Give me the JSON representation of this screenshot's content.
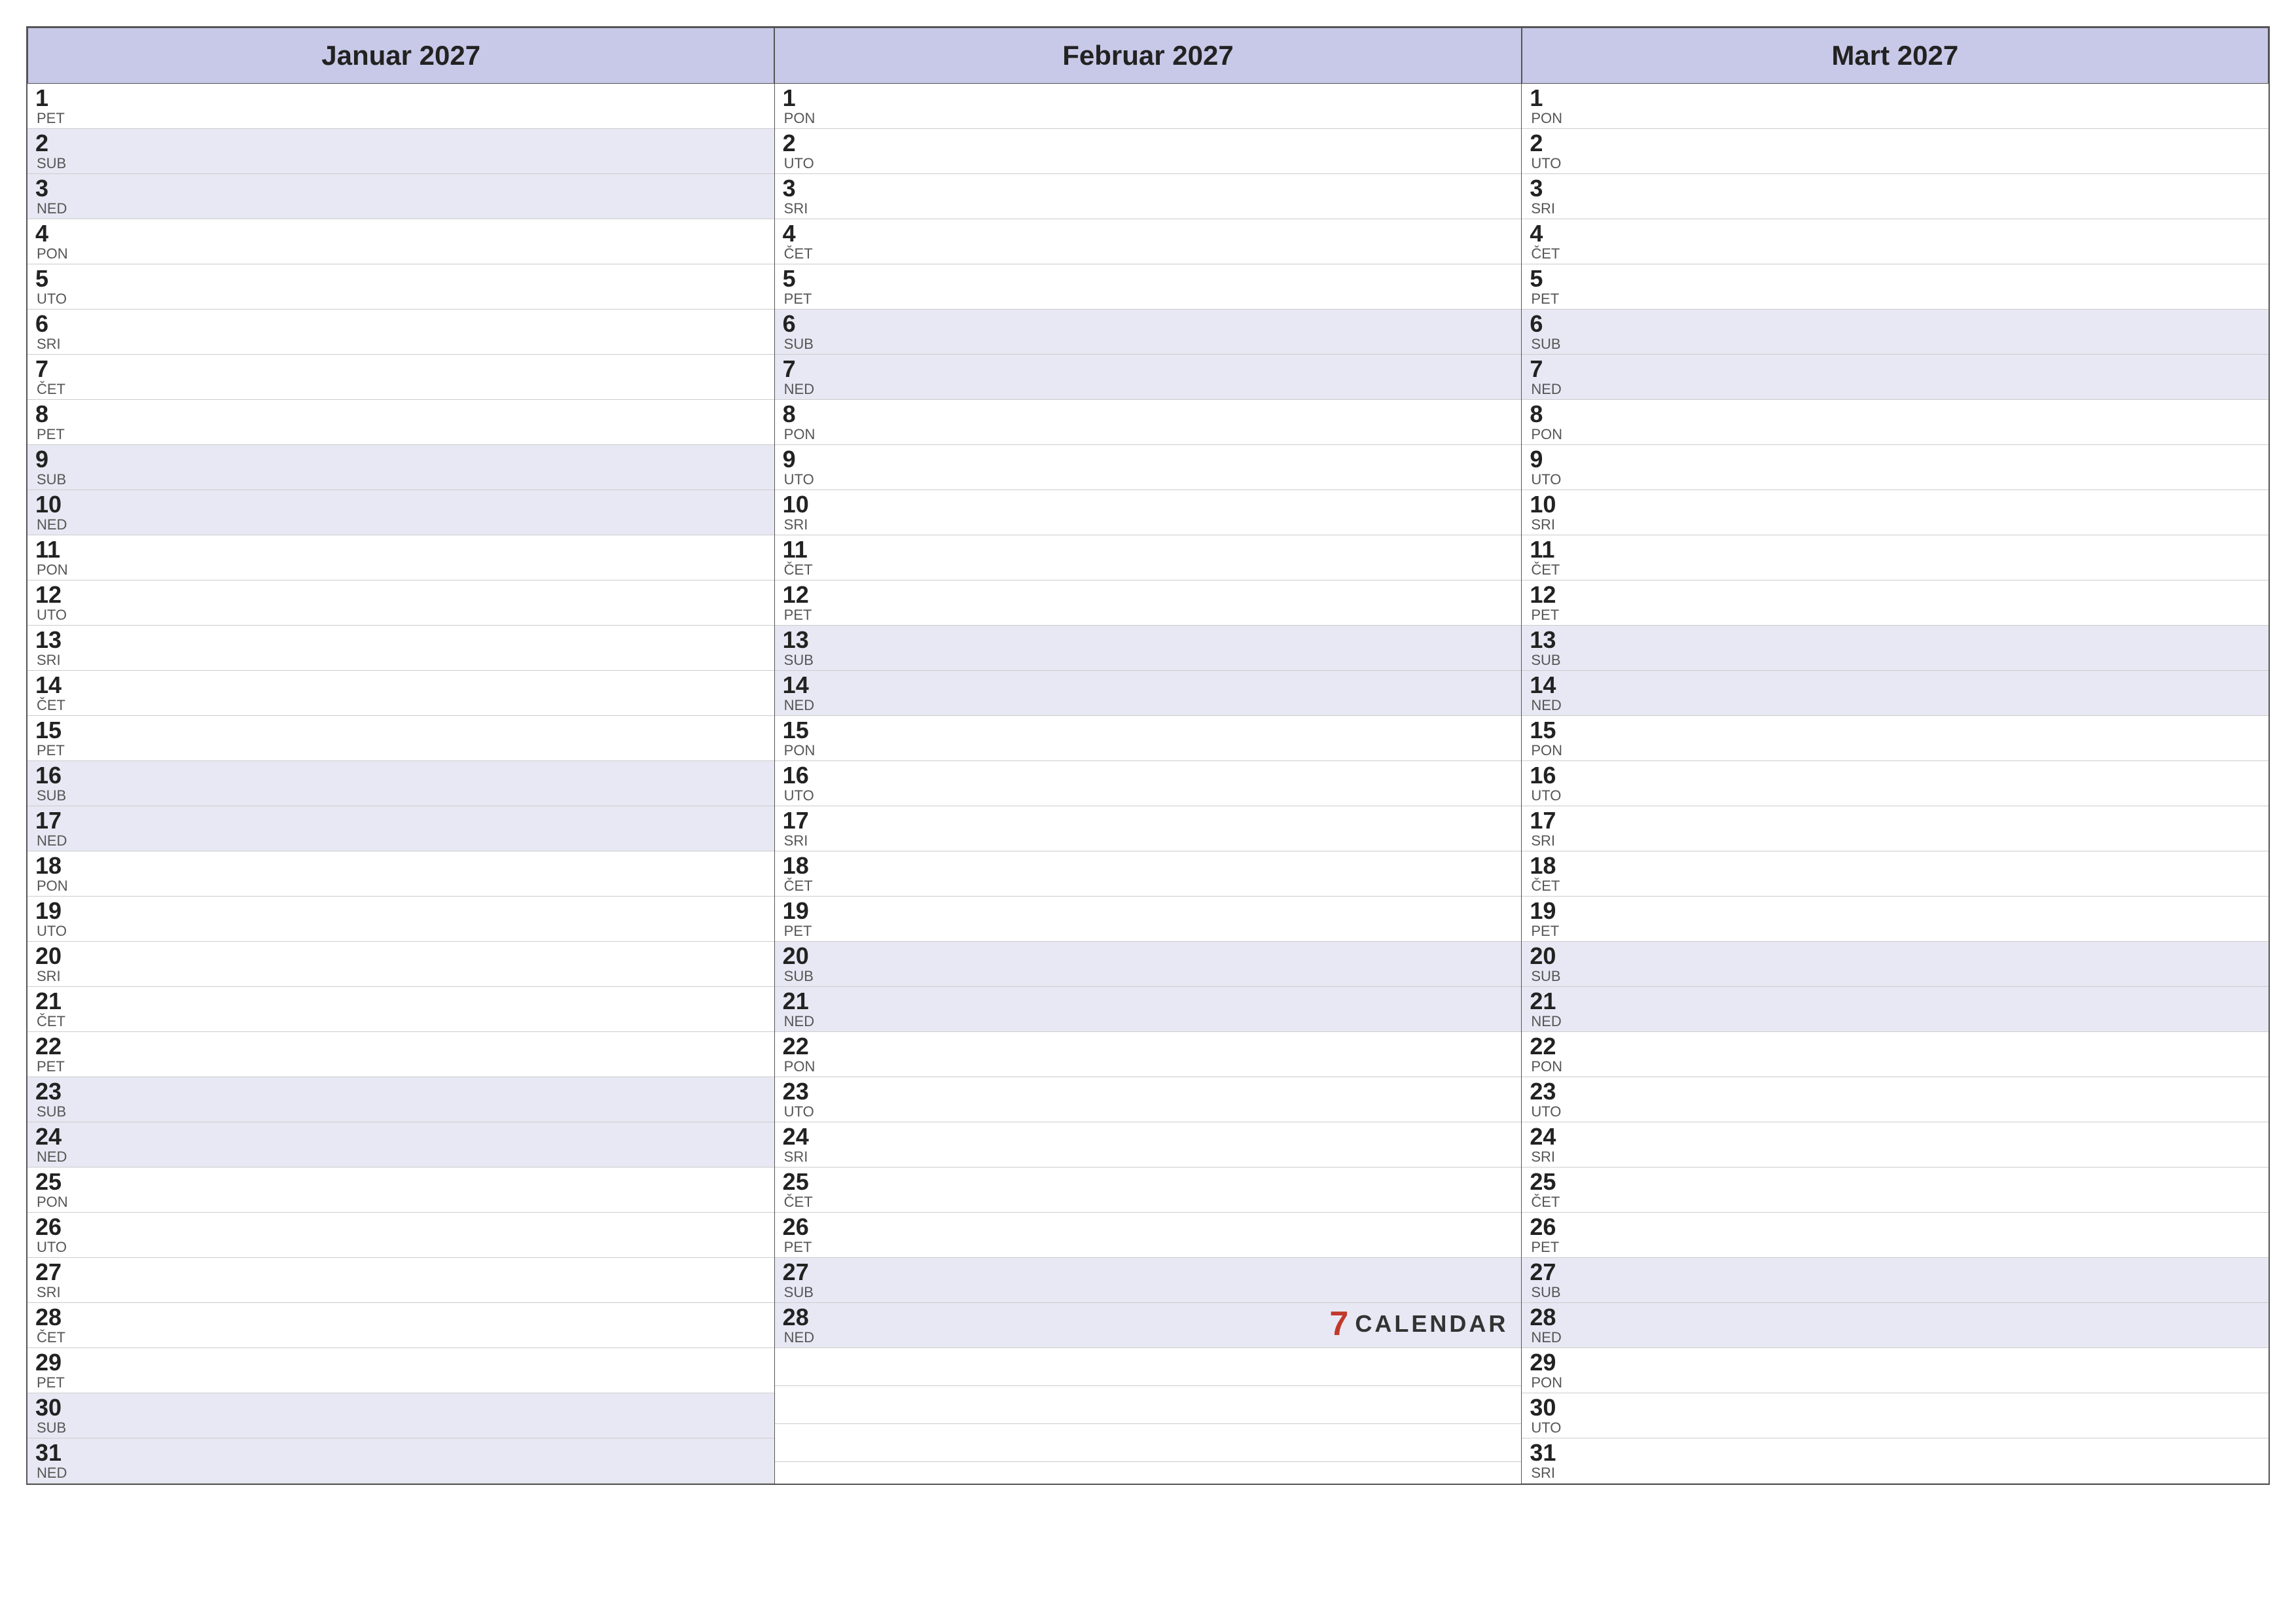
{
  "calendar": {
    "months": [
      {
        "id": "jan-2027",
        "title": "Januar 2027",
        "days": [
          {
            "num": "1",
            "name": "PET",
            "weekend": false
          },
          {
            "num": "2",
            "name": "SUB",
            "weekend": true
          },
          {
            "num": "3",
            "name": "NED",
            "weekend": true
          },
          {
            "num": "4",
            "name": "PON",
            "weekend": false
          },
          {
            "num": "5",
            "name": "UTO",
            "weekend": false
          },
          {
            "num": "6",
            "name": "SRI",
            "weekend": false
          },
          {
            "num": "7",
            "name": "ČET",
            "weekend": false
          },
          {
            "num": "8",
            "name": "PET",
            "weekend": false
          },
          {
            "num": "9",
            "name": "SUB",
            "weekend": true
          },
          {
            "num": "10",
            "name": "NED",
            "weekend": true
          },
          {
            "num": "11",
            "name": "PON",
            "weekend": false
          },
          {
            "num": "12",
            "name": "UTO",
            "weekend": false
          },
          {
            "num": "13",
            "name": "SRI",
            "weekend": false
          },
          {
            "num": "14",
            "name": "ČET",
            "weekend": false
          },
          {
            "num": "15",
            "name": "PET",
            "weekend": false
          },
          {
            "num": "16",
            "name": "SUB",
            "weekend": true
          },
          {
            "num": "17",
            "name": "NED",
            "weekend": true
          },
          {
            "num": "18",
            "name": "PON",
            "weekend": false
          },
          {
            "num": "19",
            "name": "UTO",
            "weekend": false
          },
          {
            "num": "20",
            "name": "SRI",
            "weekend": false
          },
          {
            "num": "21",
            "name": "ČET",
            "weekend": false
          },
          {
            "num": "22",
            "name": "PET",
            "weekend": false
          },
          {
            "num": "23",
            "name": "SUB",
            "weekend": true
          },
          {
            "num": "24",
            "name": "NED",
            "weekend": true
          },
          {
            "num": "25",
            "name": "PON",
            "weekend": false
          },
          {
            "num": "26",
            "name": "UTO",
            "weekend": false
          },
          {
            "num": "27",
            "name": "SRI",
            "weekend": false
          },
          {
            "num": "28",
            "name": "ČET",
            "weekend": false
          },
          {
            "num": "29",
            "name": "PET",
            "weekend": false
          },
          {
            "num": "30",
            "name": "SUB",
            "weekend": true
          },
          {
            "num": "31",
            "name": "NED",
            "weekend": true
          }
        ]
      },
      {
        "id": "feb-2027",
        "title": "Februar 2027",
        "days": [
          {
            "num": "1",
            "name": "PON",
            "weekend": false
          },
          {
            "num": "2",
            "name": "UTO",
            "weekend": false
          },
          {
            "num": "3",
            "name": "SRI",
            "weekend": false
          },
          {
            "num": "4",
            "name": "ČET",
            "weekend": false
          },
          {
            "num": "5",
            "name": "PET",
            "weekend": false
          },
          {
            "num": "6",
            "name": "SUB",
            "weekend": true
          },
          {
            "num": "7",
            "name": "NED",
            "weekend": true
          },
          {
            "num": "8",
            "name": "PON",
            "weekend": false
          },
          {
            "num": "9",
            "name": "UTO",
            "weekend": false
          },
          {
            "num": "10",
            "name": "SRI",
            "weekend": false
          },
          {
            "num": "11",
            "name": "ČET",
            "weekend": false
          },
          {
            "num": "12",
            "name": "PET",
            "weekend": false
          },
          {
            "num": "13",
            "name": "SUB",
            "weekend": true
          },
          {
            "num": "14",
            "name": "NED",
            "weekend": true
          },
          {
            "num": "15",
            "name": "PON",
            "weekend": false
          },
          {
            "num": "16",
            "name": "UTO",
            "weekend": false
          },
          {
            "num": "17",
            "name": "SRI",
            "weekend": false
          },
          {
            "num": "18",
            "name": "ČET",
            "weekend": false
          },
          {
            "num": "19",
            "name": "PET",
            "weekend": false
          },
          {
            "num": "20",
            "name": "SUB",
            "weekend": true
          },
          {
            "num": "21",
            "name": "NED",
            "weekend": true
          },
          {
            "num": "22",
            "name": "PON",
            "weekend": false
          },
          {
            "num": "23",
            "name": "UTO",
            "weekend": false
          },
          {
            "num": "24",
            "name": "SRI",
            "weekend": false
          },
          {
            "num": "25",
            "name": "ČET",
            "weekend": false
          },
          {
            "num": "26",
            "name": "PET",
            "weekend": false
          },
          {
            "num": "27",
            "name": "SUB",
            "weekend": true
          },
          {
            "num": "28",
            "name": "NED",
            "weekend": true
          }
        ]
      },
      {
        "id": "mar-2027",
        "title": "Mart 2027",
        "days": [
          {
            "num": "1",
            "name": "PON",
            "weekend": false
          },
          {
            "num": "2",
            "name": "UTO",
            "weekend": false
          },
          {
            "num": "3",
            "name": "SRI",
            "weekend": false
          },
          {
            "num": "4",
            "name": "ČET",
            "weekend": false
          },
          {
            "num": "5",
            "name": "PET",
            "weekend": false
          },
          {
            "num": "6",
            "name": "SUB",
            "weekend": true
          },
          {
            "num": "7",
            "name": "NED",
            "weekend": true
          },
          {
            "num": "8",
            "name": "PON",
            "weekend": false
          },
          {
            "num": "9",
            "name": "UTO",
            "weekend": false
          },
          {
            "num": "10",
            "name": "SRI",
            "weekend": false
          },
          {
            "num": "11",
            "name": "ČET",
            "weekend": false
          },
          {
            "num": "12",
            "name": "PET",
            "weekend": false
          },
          {
            "num": "13",
            "name": "SUB",
            "weekend": true
          },
          {
            "num": "14",
            "name": "NED",
            "weekend": true
          },
          {
            "num": "15",
            "name": "PON",
            "weekend": false
          },
          {
            "num": "16",
            "name": "UTO",
            "weekend": false
          },
          {
            "num": "17",
            "name": "SRI",
            "weekend": false
          },
          {
            "num": "18",
            "name": "ČET",
            "weekend": false
          },
          {
            "num": "19",
            "name": "PET",
            "weekend": false
          },
          {
            "num": "20",
            "name": "SUB",
            "weekend": true
          },
          {
            "num": "21",
            "name": "NED",
            "weekend": true
          },
          {
            "num": "22",
            "name": "PON",
            "weekend": false
          },
          {
            "num": "23",
            "name": "UTO",
            "weekend": false
          },
          {
            "num": "24",
            "name": "SRI",
            "weekend": false
          },
          {
            "num": "25",
            "name": "ČET",
            "weekend": false
          },
          {
            "num": "26",
            "name": "PET",
            "weekend": false
          },
          {
            "num": "27",
            "name": "SUB",
            "weekend": true
          },
          {
            "num": "28",
            "name": "NED",
            "weekend": true
          },
          {
            "num": "29",
            "name": "PON",
            "weekend": false
          },
          {
            "num": "30",
            "name": "UTO",
            "weekend": false
          },
          {
            "num": "31",
            "name": "SRI",
            "weekend": false
          }
        ]
      }
    ],
    "brand": {
      "icon": "7",
      "text": "CALENDAR"
    }
  }
}
